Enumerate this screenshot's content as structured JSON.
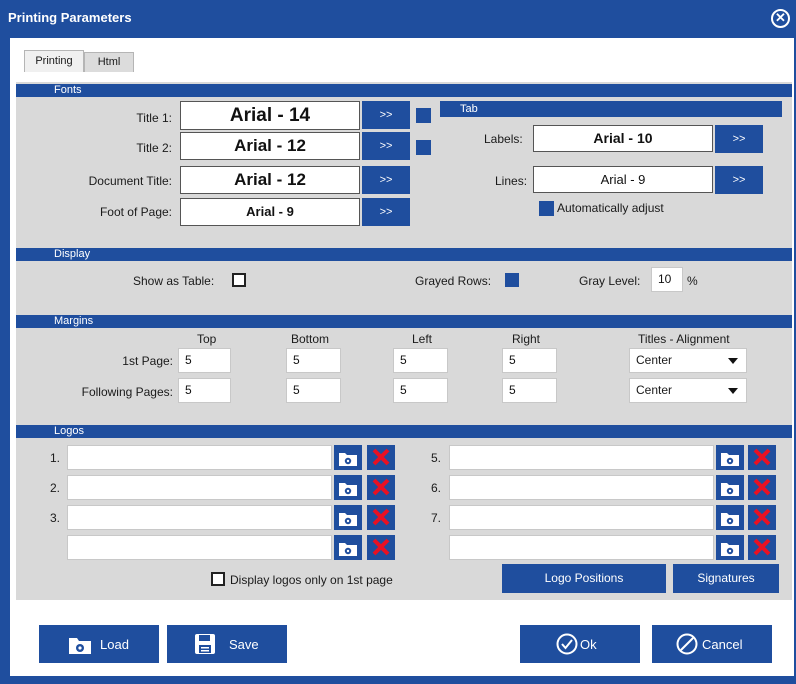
{
  "window": {
    "title": "Printing Parameters",
    "close_glyph": "✕"
  },
  "tabs": [
    {
      "label": "Printing"
    },
    {
      "label": "Html"
    }
  ],
  "fonts": {
    "header": "Fonts",
    "rows": [
      {
        "label": "Title 1:",
        "font": "Arial - 14"
      },
      {
        "label": "Title 2:",
        "font": "Arial - 12"
      },
      {
        "label": "Document Title:",
        "font": "Arial - 12"
      },
      {
        "label": "Foot of Page:",
        "font": "Arial - 9"
      }
    ],
    "button_label": ">>"
  },
  "tab_section": {
    "header": "Tab",
    "labels": {
      "label": "Labels:",
      "font": "Arial - 10"
    },
    "lines": {
      "label": "Lines:",
      "font": "Arial - 9"
    },
    "auto_adjust": "Automatically adjust"
  },
  "display": {
    "header": "Display",
    "show_as_table": "Show as Table:",
    "grayed_rows": "Grayed Rows:",
    "gray_level": "Gray Level:",
    "gray_level_value": "10",
    "gray_level_unit": "%"
  },
  "margins": {
    "header": "Margins",
    "columns": {
      "top": "Top",
      "bottom": "Bottom",
      "left": "Left",
      "right": "Right",
      "alignment": "Titles - Alignment"
    },
    "rows": [
      {
        "label": "1st Page:",
        "top": "5",
        "bottom": "5",
        "left": "5",
        "right": "5",
        "alignment": "Center"
      },
      {
        "label": "Following Pages:",
        "top": "5",
        "bottom": "5",
        "left": "5",
        "right": "5",
        "alignment": "Center"
      }
    ]
  },
  "logos": {
    "header": "Logos",
    "left_numbers": [
      "1.",
      "2.",
      "3.",
      ""
    ],
    "right_numbers": [
      "5.",
      "6.",
      "7.",
      ""
    ],
    "display_first_page": "Display logos only on 1st page",
    "logo_positions": "Logo Positions",
    "signatures": "Signatures"
  },
  "footer": {
    "load": "Load",
    "save": "Save",
    "ok": "Ok",
    "cancel": "Cancel"
  },
  "colors": {
    "accent": "#1f4e9e",
    "panel": "#d9d9d9",
    "delete": "#e81123"
  },
  "icons": [
    "close-icon",
    "folder-icon",
    "delete-icon",
    "save-icon",
    "checkmark-icon",
    "cancel-icon"
  ]
}
